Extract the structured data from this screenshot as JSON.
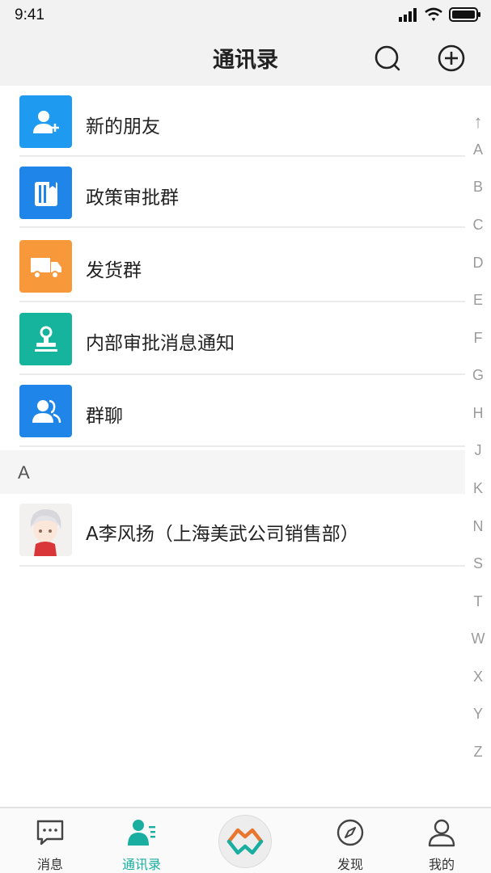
{
  "status_bar": {
    "time": "9:41"
  },
  "nav": {
    "title": "通讯录",
    "search_icon": "search-icon",
    "add_icon": "plus-circle-icon"
  },
  "fixed_items": [
    {
      "label": "新的朋友",
      "icon": "add-person-icon",
      "color": "#1e9bf0"
    },
    {
      "label": "政策审批群",
      "icon": "document-list-icon",
      "color": "#1f85e8"
    },
    {
      "label": "发货群",
      "icon": "truck-icon",
      "color": "#f7993a"
    },
    {
      "label": "内部审批消息通知",
      "icon": "stamp-icon",
      "color": "#17b49d"
    },
    {
      "label": "群聊",
      "icon": "group-icon",
      "color": "#1f85e8"
    }
  ],
  "section": {
    "letter": "A"
  },
  "contacts": [
    {
      "name": "A李风扬（上海美武公司销售部）",
      "icon": "avatar-image"
    }
  ],
  "index_bar": [
    "↑",
    "A",
    "B",
    "C",
    "D",
    "E",
    "F",
    "G",
    "H",
    "J",
    "K",
    "N",
    "S",
    "T",
    "W",
    "X",
    "Y",
    "Z"
  ],
  "tabs": [
    {
      "label": "消息",
      "icon": "chat-bubble-icon",
      "active": false
    },
    {
      "label": "通讯录",
      "icon": "contacts-icon",
      "active": true
    },
    {
      "label": "发现",
      "icon": "compass-icon",
      "active": false
    },
    {
      "label": "我的",
      "icon": "person-icon",
      "active": false
    }
  ],
  "center_button": {
    "icon": "app-logo-icon"
  },
  "colors": {
    "accent": "#1aaea1",
    "header_bg": "#f2f2f2",
    "index_text": "#9a9a9a"
  }
}
